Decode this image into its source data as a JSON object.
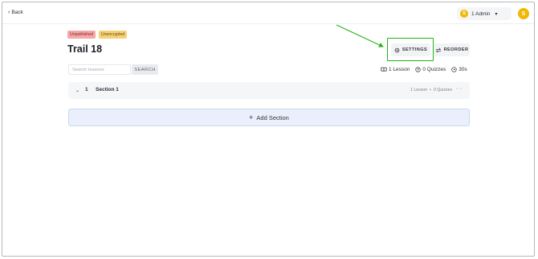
{
  "header": {
    "back_label": "Back",
    "user_initial": "S",
    "user_name": "1 Admin"
  },
  "course": {
    "badges": [
      "Unpublished",
      "Unencrypted"
    ],
    "title": "Trail 18"
  },
  "actions": {
    "settings_label": "SETTINGS",
    "reorder_label": "REORDER"
  },
  "search": {
    "placeholder": "Search lessons",
    "value": "",
    "button_label": "SEARCH"
  },
  "stats": {
    "lessons": "1 Lesson",
    "quizzes": "0 Quizzes",
    "duration": "30s"
  },
  "sections": [
    {
      "number": "1",
      "name": "Section 1",
      "lessons": "1 Lesson",
      "separator": "•",
      "quizzes": "0 Quizzes",
      "more": "···"
    }
  ],
  "add_section_label": "Add Section",
  "colors": {
    "avatar": "#f2b705",
    "badge_unpublished": "#f3a9a9",
    "badge_unencrypted": "#f5d27a",
    "highlight": "#1fb313",
    "add_section_bg": "#e9f0fb"
  }
}
